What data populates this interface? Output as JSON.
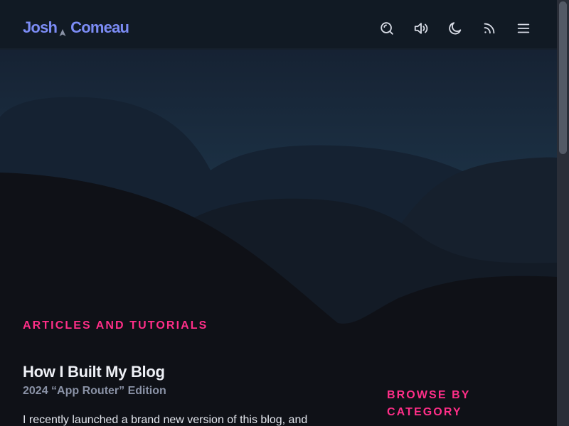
{
  "header": {
    "logo": {
      "first": "Josh",
      "last": "Comeau",
      "mark_icon": "cursor-arrow-icon"
    },
    "nav_icons": [
      {
        "name": "search-icon",
        "label": "Search"
      },
      {
        "name": "sound-on-icon",
        "label": "Toggle sound"
      },
      {
        "name": "moon-icon",
        "label": "Toggle dark mode"
      },
      {
        "name": "rss-icon",
        "label": "RSS feed"
      },
      {
        "name": "menu-icon",
        "label": "Menu"
      }
    ]
  },
  "main": {
    "section_kicker": "Articles and Tutorials",
    "articles": [
      {
        "title": "How I Built My Blog",
        "subtitle": "2024 “App Router” Edition",
        "excerpt": "I recently launched a brand new version of this blog, and"
      }
    ]
  },
  "sidebar": {
    "browse_heading": "Browse by Category"
  },
  "colors": {
    "accent_pink": "#ff2e88",
    "logo_blue": "#7c8cf5",
    "background": "#0f1117",
    "header_bg": "#111a24",
    "icon": "#d8dce6"
  }
}
